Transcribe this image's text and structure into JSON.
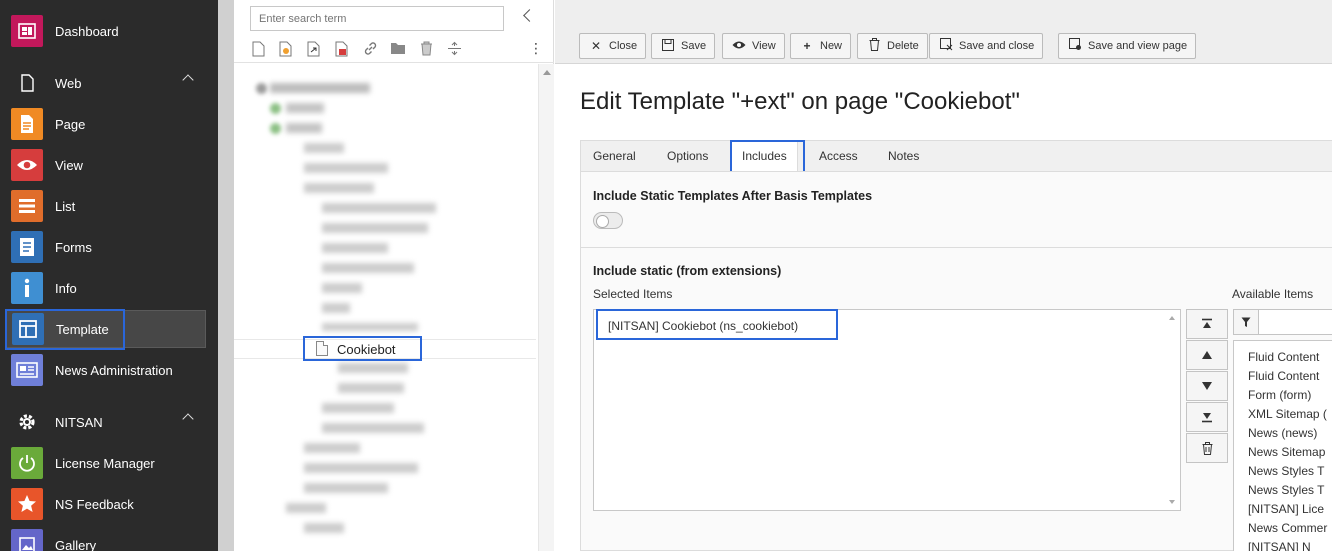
{
  "modules": [
    {
      "key": "dashboard",
      "label": "Dashboard",
      "icon": "dashboard-icon",
      "color": "#c2185b",
      "kind": "item"
    },
    {
      "key": "web",
      "label": "Web",
      "icon": "document-icon",
      "kind": "group"
    },
    {
      "key": "page",
      "label": "Page",
      "icon": "page-icon",
      "color": "#f08a24",
      "kind": "item"
    },
    {
      "key": "view",
      "label": "View",
      "icon": "eye-icon",
      "color": "#d63d3d",
      "kind": "item"
    },
    {
      "key": "list",
      "label": "List",
      "icon": "list-icon",
      "color": "#e06d2b",
      "kind": "item"
    },
    {
      "key": "forms",
      "label": "Forms",
      "icon": "forms-icon",
      "color": "#2f6fb5",
      "kind": "item"
    },
    {
      "key": "info",
      "label": "Info",
      "icon": "info-icon",
      "color": "#3f8fd2",
      "kind": "item"
    },
    {
      "key": "template",
      "label": "Template",
      "icon": "template-icon",
      "color": "#2f6fb5",
      "kind": "item",
      "active": true
    },
    {
      "key": "news",
      "label": "News Administration",
      "icon": "news-icon",
      "color": "#6f7fd8",
      "kind": "item"
    },
    {
      "key": "nitsan",
      "label": "NITSAN",
      "icon": "gear-icon",
      "kind": "group"
    },
    {
      "key": "license",
      "label": "License Manager",
      "icon": "power-icon",
      "color": "#6aaa3a",
      "kind": "item"
    },
    {
      "key": "feedback",
      "label": "NS Feedback",
      "icon": "star-icon",
      "color": "#e8552a",
      "kind": "item"
    },
    {
      "key": "gallery",
      "label": "Gallery",
      "icon": "gallery-icon",
      "color": "#6466c9",
      "kind": "item"
    }
  ],
  "tree": {
    "search_placeholder": "Enter search term",
    "selected_label": "Cookiebot"
  },
  "header_buttons": [
    {
      "key": "close",
      "label": "Close",
      "icon": "close-icon"
    },
    {
      "key": "save",
      "label": "Save",
      "icon": "save-icon"
    },
    {
      "key": "view",
      "label": "View",
      "icon": "eye-icon"
    },
    {
      "key": "new",
      "label": "New",
      "icon": "plus-icon"
    },
    {
      "key": "delete",
      "label": "Delete",
      "icon": "trash-icon"
    },
    {
      "key": "save-close",
      "label": "Save and close",
      "icon": "save-close-icon"
    },
    {
      "key": "save-view",
      "label": "Save and view page",
      "icon": "save-view-icon"
    }
  ],
  "page_title": "Edit Template \"+ext\" on page \"Cookiebot\"",
  "tabs": [
    {
      "label": "General",
      "active": false
    },
    {
      "label": "Options",
      "active": false
    },
    {
      "label": "Includes",
      "active": true
    },
    {
      "label": "Access",
      "active": false
    },
    {
      "label": "Notes",
      "active": false
    }
  ],
  "includes": {
    "static_after_title": "Include Static Templates After Basis Templates",
    "static_after_enabled": false,
    "static_ext_title": "Include static (from extensions)",
    "selected_label": "Selected Items",
    "available_label": "Available Items",
    "selected_items": [
      "[NITSAN] Cookiebot (ns_cookiebot)"
    ],
    "available_items": [
      "Fluid Content",
      "Fluid Content",
      "Form (form)",
      "XML Sitemap (",
      "News (news)",
      "News Sitemap",
      "News Styles T",
      "News Styles T",
      "[NITSAN] Lice",
      "News Commer",
      "[NITSAN] N"
    ]
  }
}
